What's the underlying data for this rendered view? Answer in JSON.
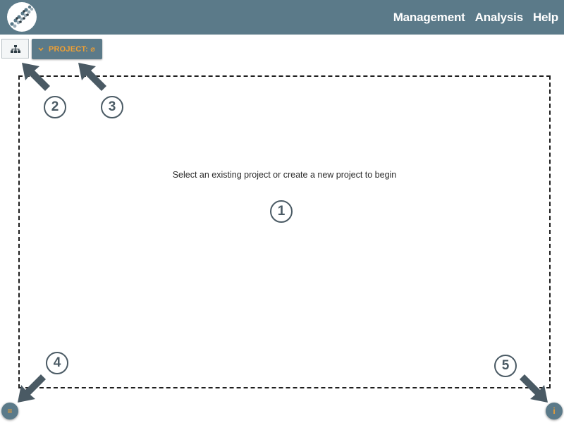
{
  "header": {
    "logo_icon": "dna-helix-logo-icon",
    "nav": [
      "Management",
      "Analysis",
      "Help"
    ]
  },
  "toolbar": {
    "tree_icon": "sitemap-icon",
    "project_label": "PROJECT: ⌀",
    "project_icon": "chevron-down-icon"
  },
  "workspace": {
    "empty_message": "Select an existing project or create a new project to begin"
  },
  "annotations": {
    "markers": [
      "1",
      "2",
      "3",
      "4",
      "5"
    ]
  },
  "footer": {
    "menu_icon": "menu-icon",
    "menu_glyph": "≡",
    "info_icon": "info-icon",
    "info_glyph": "i"
  },
  "colors": {
    "header_bg": "#5b7a89",
    "accent": "#f0a033",
    "marker": "#4a5a64"
  }
}
